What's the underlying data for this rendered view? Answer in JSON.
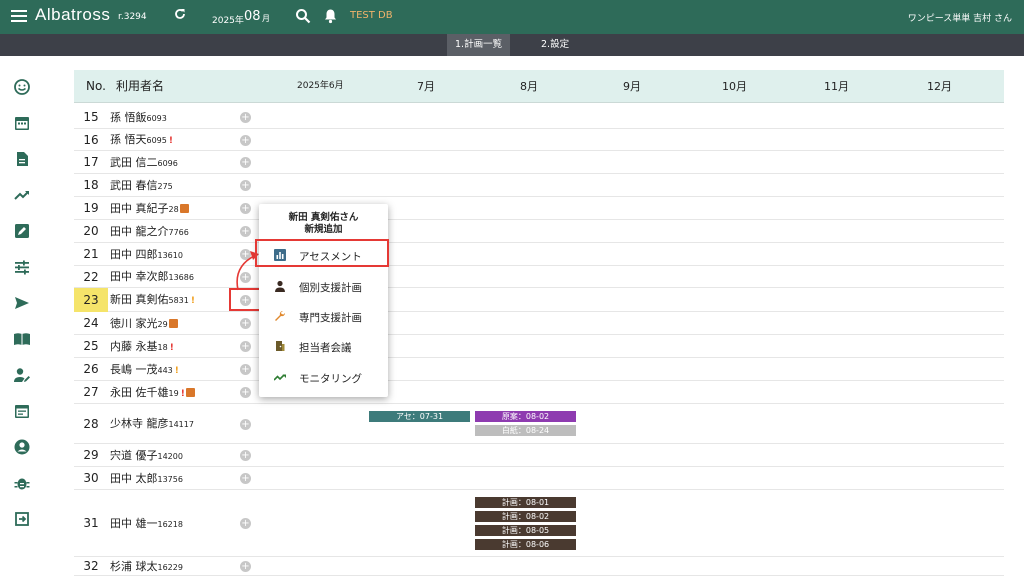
{
  "header": {
    "app_title": "Albatross",
    "version": "r.3294",
    "year": "2025年",
    "month": "08",
    "month_unit": "月",
    "db_name": "TEST DB",
    "user": "ワンピース単単 吉村 さん"
  },
  "tabs": [
    {
      "label": "1.計画一覧",
      "active": true
    },
    {
      "label": "2.設定",
      "active": false
    }
  ],
  "sidebar": {
    "icons": [
      "smile-icon",
      "calendar-icon",
      "document-icon",
      "trending-icon",
      "edit-icon",
      "tune-icon",
      "send-icon",
      "book-icon",
      "person-edit-icon",
      "event-note-icon",
      "account-circle-icon",
      "bug-icon",
      "exit-icon"
    ]
  },
  "table": {
    "col_no": "No.",
    "col_name": "利用者名",
    "months": [
      "2025年6月",
      "7月",
      "8月",
      "9月",
      "10月",
      "11月",
      "12月"
    ],
    "rows": [
      {
        "no": "15",
        "name": "孫 悟飯",
        "id": "6093",
        "mark": "",
        "gift": false
      },
      {
        "no": "16",
        "name": "孫 悟天",
        "id": "6095",
        "mark": "!",
        "mark_color": "#e53935",
        "gift": false
      },
      {
        "no": "17",
        "name": "武田 信二",
        "id": "6096",
        "mark": "",
        "gift": false
      },
      {
        "no": "18",
        "name": "武田 春信",
        "id": "275",
        "mark": "",
        "gift": false
      },
      {
        "no": "19",
        "name": "田中 真紀子",
        "id": "28",
        "mark": "",
        "gift": true
      },
      {
        "no": "20",
        "name": "田中 龍之介",
        "id": "7766",
        "mark": "",
        "gift": false
      },
      {
        "no": "21",
        "name": "田中 四郎",
        "id": "13610",
        "mark": "",
        "gift": false
      },
      {
        "no": "22",
        "name": "田中 幸次郎",
        "id": "13686",
        "mark": "",
        "gift": false
      },
      {
        "no": "23",
        "name": "新田 真剣佑",
        "id": "5831",
        "mark": "!",
        "mark_color": "#f0a020",
        "gift": false
      },
      {
        "no": "24",
        "name": "徳川 家光",
        "id": "29",
        "mark": "",
        "gift": true
      },
      {
        "no": "25",
        "name": "内藤 永基",
        "id": "18",
        "mark": "!",
        "mark_color": "#e53935",
        "gift": false
      },
      {
        "no": "26",
        "name": "長嶋 一茂",
        "id": "443",
        "mark": "!",
        "mark_color": "#f0a020",
        "gift": false
      },
      {
        "no": "27",
        "name": "永田 佐千雄",
        "id": "19",
        "mark": "!",
        "mark_color": "#e53935",
        "gift": true
      },
      {
        "no": "28",
        "name": "少林寺 龍彦",
        "id": "14117",
        "mark": "",
        "gift": false
      },
      {
        "no": "29",
        "name": "宍道 優子",
        "id": "14200",
        "mark": "",
        "gift": false
      },
      {
        "no": "30",
        "name": "田中 太郎",
        "id": "13756",
        "mark": "",
        "gift": false
      },
      {
        "no": "31",
        "name": "田中 雄一",
        "id": "16218",
        "mark": "",
        "gift": false
      },
      {
        "no": "32",
        "name": "杉浦 球太",
        "id": "16229",
        "mark": "",
        "gift": false
      }
    ],
    "add_symbol": "+"
  },
  "bars": {
    "r28_a": "アセ：07-31",
    "r28_b": "原案：08-02",
    "r28_c": "白紙：08-24",
    "r31_a": "計画：08-01",
    "r31_b": "計画：08-02",
    "r31_c": "計画：08-05",
    "r31_d": "計画：08-06"
  },
  "popup": {
    "title_line1": "新田 真剣佑さん",
    "title_line2": "新規追加",
    "items": [
      {
        "label": "アセスメント",
        "icon": "bar-chart-icon"
      },
      {
        "label": "個別支援計画",
        "icon": "person-icon"
      },
      {
        "label": "専門支援計画",
        "icon": "wrench-icon"
      },
      {
        "label": "担当者会議",
        "icon": "meeting-door-icon"
      },
      {
        "label": "モニタリング",
        "icon": "monitoring-trend-icon"
      }
    ]
  },
  "colors": {
    "topbar": "#2e6b59",
    "subbar": "#3d4048",
    "accent_red": "#e53935",
    "bar_teal": "#3d7b7b",
    "bar_purple": "#8e3bb0",
    "bar_gray": "#bdbdbd",
    "bar_brown": "#4a3a30"
  }
}
